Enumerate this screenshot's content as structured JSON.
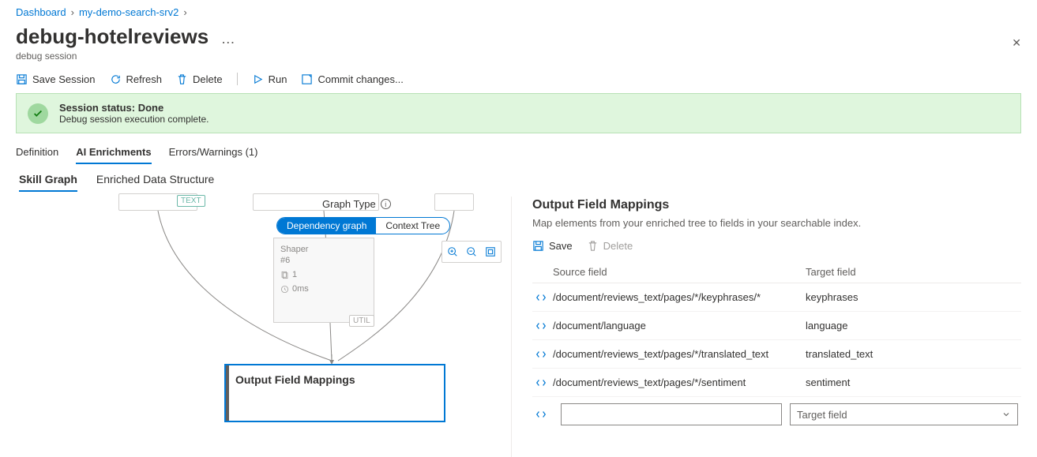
{
  "breadcrumb": {
    "parts": [
      "Dashboard",
      "my-demo-search-srv2"
    ]
  },
  "page": {
    "title": "debug-hotelreviews",
    "subtitle": "debug session"
  },
  "toolbar": {
    "save": "Save Session",
    "refresh": "Refresh",
    "delete": "Delete",
    "run": "Run",
    "commit": "Commit changes..."
  },
  "status": {
    "title": "Session status: Done",
    "msg": "Debug session execution complete."
  },
  "tabs": {
    "definition": "Definition",
    "ai": "AI Enrichments",
    "errors": "Errors/Warnings (1)"
  },
  "subtabs": {
    "skill": "Skill Graph",
    "enriched": "Enriched Data Structure"
  },
  "graph": {
    "type_label": "Graph Type",
    "dep": "Dependency graph",
    "ctx": "Context Tree",
    "shaper": {
      "title": "Shaper",
      "id": "#6",
      "count": "1",
      "time": "0ms"
    },
    "ofm": "Output Field Mappings",
    "tag_text": "TEXT",
    "tag_util": "UTIL"
  },
  "right": {
    "title": "Output Field Mappings",
    "desc": "Map elements from your enriched tree to fields in your searchable index.",
    "save": "Save",
    "delete": "Delete",
    "col_src": "Source field",
    "col_tgt": "Target field",
    "rows": [
      {
        "src": "/document/reviews_text/pages/*/keyphrases/*",
        "tgt": "keyphrases"
      },
      {
        "src": "/document/language",
        "tgt": "language"
      },
      {
        "src": "/document/reviews_text/pages/*/translated_text",
        "tgt": "translated_text"
      },
      {
        "src": "/document/reviews_text/pages/*/sentiment",
        "tgt": "sentiment"
      }
    ],
    "new_row": {
      "src_placeholder": "",
      "tgt_placeholder": "Target field"
    }
  }
}
